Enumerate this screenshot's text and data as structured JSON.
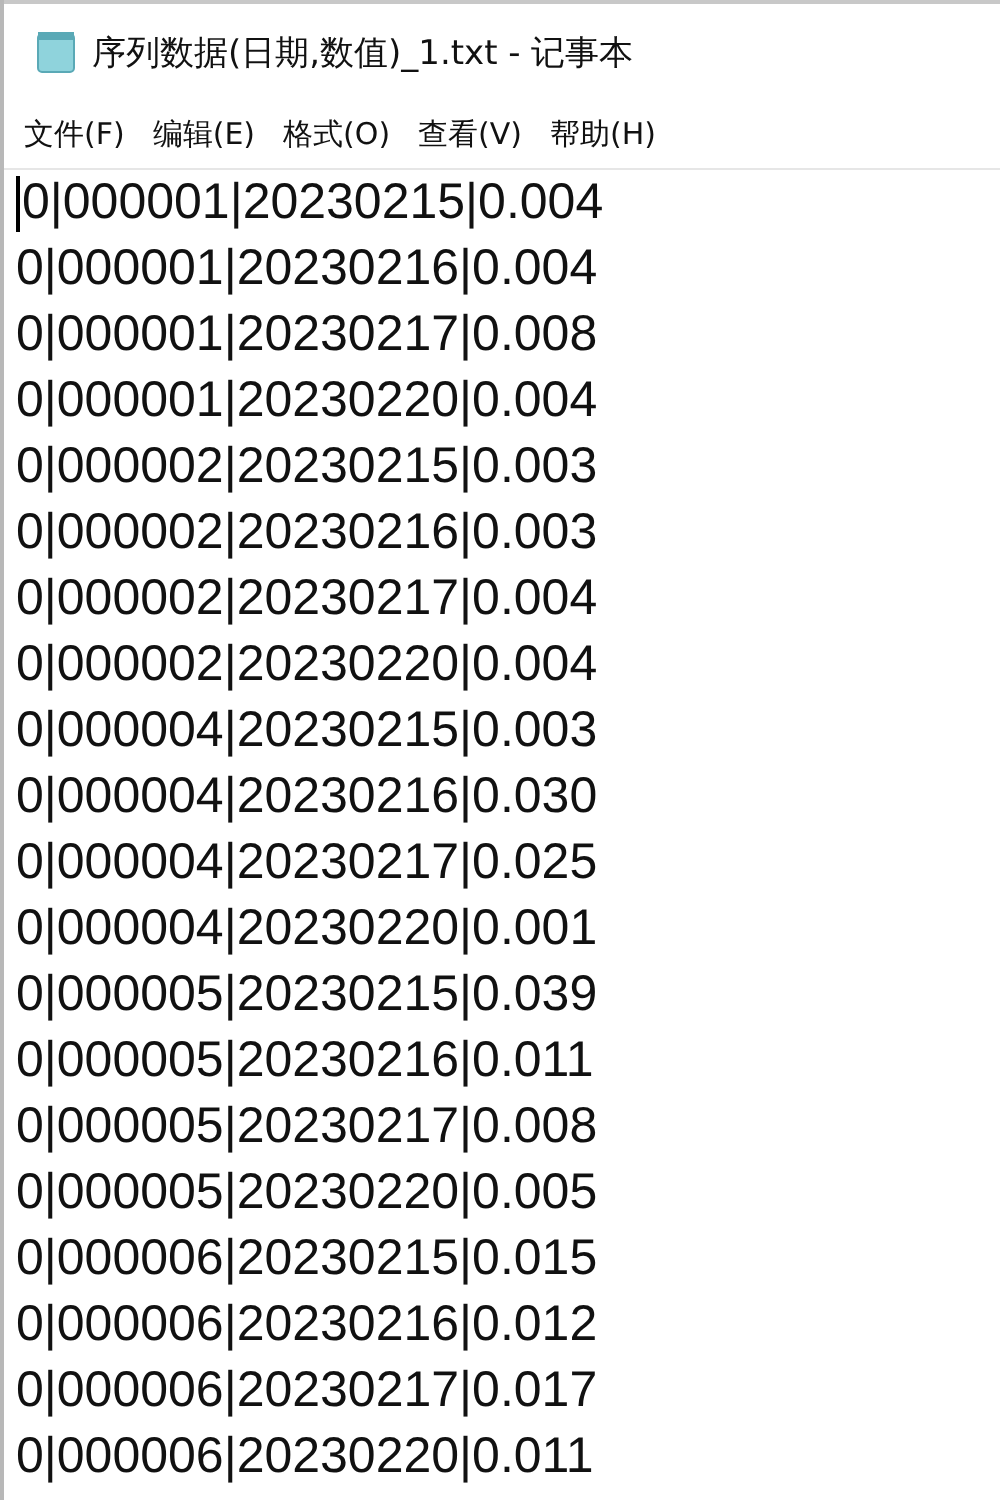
{
  "window": {
    "title": "序列数据(日期,数值)_1.txt - 记事本"
  },
  "menu": [
    "文件(F)",
    "编辑(E)",
    "格式(O)",
    "查看(V)",
    "帮助(H)"
  ],
  "lines": [
    "0|000001|20230215|0.004",
    "0|000001|20230216|0.004",
    "0|000001|20230217|0.008",
    "0|000001|20230220|0.004",
    "0|000002|20230215|0.003",
    "0|000002|20230216|0.003",
    "0|000002|20230217|0.004",
    "0|000002|20230220|0.004",
    "0|000004|20230215|0.003",
    "0|000004|20230216|0.030",
    "0|000004|20230217|0.025",
    "0|000004|20230220|0.001",
    "0|000005|20230215|0.039",
    "0|000005|20230216|0.011",
    "0|000005|20230217|0.008",
    "0|000005|20230220|0.005",
    "0|000006|20230215|0.015",
    "0|000006|20230216|0.012",
    "0|000006|20230217|0.017",
    "0|000006|20230220|0.011"
  ]
}
